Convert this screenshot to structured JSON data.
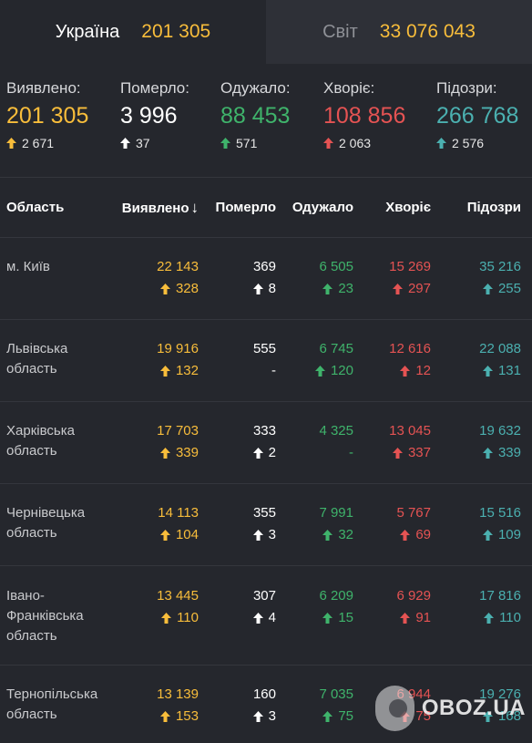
{
  "tabs": {
    "ukraine": {
      "label": "Україна",
      "value": "201 305"
    },
    "world": {
      "label": "Світ",
      "value": "33 076 043"
    }
  },
  "summary": {
    "confirmed": {
      "label": "Виявлено:",
      "value": "201 305",
      "delta": "2 671"
    },
    "deaths": {
      "label": "Померло:",
      "value": "3 996",
      "delta": "37"
    },
    "recovered": {
      "label": "Одужало:",
      "value": "88 453",
      "delta": "571"
    },
    "sick": {
      "label": "Хворіє:",
      "value": "108 856",
      "delta": "2 063"
    },
    "suspected": {
      "label": "Підозри:",
      "value": "266 768",
      "delta": "2 576"
    }
  },
  "table": {
    "headers": {
      "region": "Область",
      "confirmed": "Виявлено",
      "sort_arrow": "↓",
      "deaths": "Померло",
      "recovered": "Одужало",
      "sick": "Хворіє",
      "suspected": "Підозри"
    },
    "rows": [
      {
        "name": "м. Київ",
        "confirmed": "22 143",
        "confirmed_d": "328",
        "deaths": "369",
        "deaths_d": "8",
        "recovered": "6 505",
        "recovered_d": "23",
        "sick": "15 269",
        "sick_d": "297",
        "suspected": "35 216",
        "suspected_d": "255"
      },
      {
        "name": "Львівська область",
        "confirmed": "19 916",
        "confirmed_d": "132",
        "deaths": "555",
        "deaths_d": "-",
        "recovered": "6 745",
        "recovered_d": "120",
        "sick": "12 616",
        "sick_d": "12",
        "suspected": "22 088",
        "suspected_d": "131"
      },
      {
        "name": "Харківська область",
        "confirmed": "17 703",
        "confirmed_d": "339",
        "deaths": "333",
        "deaths_d": "2",
        "recovered": "4 325",
        "recovered_d": "-",
        "sick": "13 045",
        "sick_d": "337",
        "suspected": "19 632",
        "suspected_d": "339"
      },
      {
        "name": "Чернівецька область",
        "confirmed": "14 113",
        "confirmed_d": "104",
        "deaths": "355",
        "deaths_d": "3",
        "recovered": "7 991",
        "recovered_d": "32",
        "sick": "5 767",
        "sick_d": "69",
        "suspected": "15 516",
        "suspected_d": "109"
      },
      {
        "name": "Івано-Франківська область",
        "confirmed": "13 445",
        "confirmed_d": "110",
        "deaths": "307",
        "deaths_d": "4",
        "recovered": "6 209",
        "recovered_d": "15",
        "sick": "6 929",
        "sick_d": "91",
        "suspected": "17 816",
        "suspected_d": "110"
      },
      {
        "name": "Тернопільська область",
        "confirmed": "13 139",
        "confirmed_d": "153",
        "deaths": "160",
        "deaths_d": "3",
        "recovered": "7 035",
        "recovered_d": "75",
        "sick": "6 944",
        "sick_d": "75",
        "suspected": "19 276",
        "suspected_d": "168"
      }
    ]
  },
  "watermark": {
    "text": "OBOZ.UA"
  },
  "colors": {
    "background": "#25272d",
    "tab_inactive": "#2e3037",
    "confirmed": "#f8bd3b",
    "deaths": "#ffffff",
    "recovered": "#3fb36b",
    "sick": "#e55353",
    "suspected": "#4bb0b0"
  },
  "icons": {
    "delta": "arrow-up-icon",
    "sort": "arrow-down-icon",
    "watermark_logo": "oboz-logo-icon"
  }
}
